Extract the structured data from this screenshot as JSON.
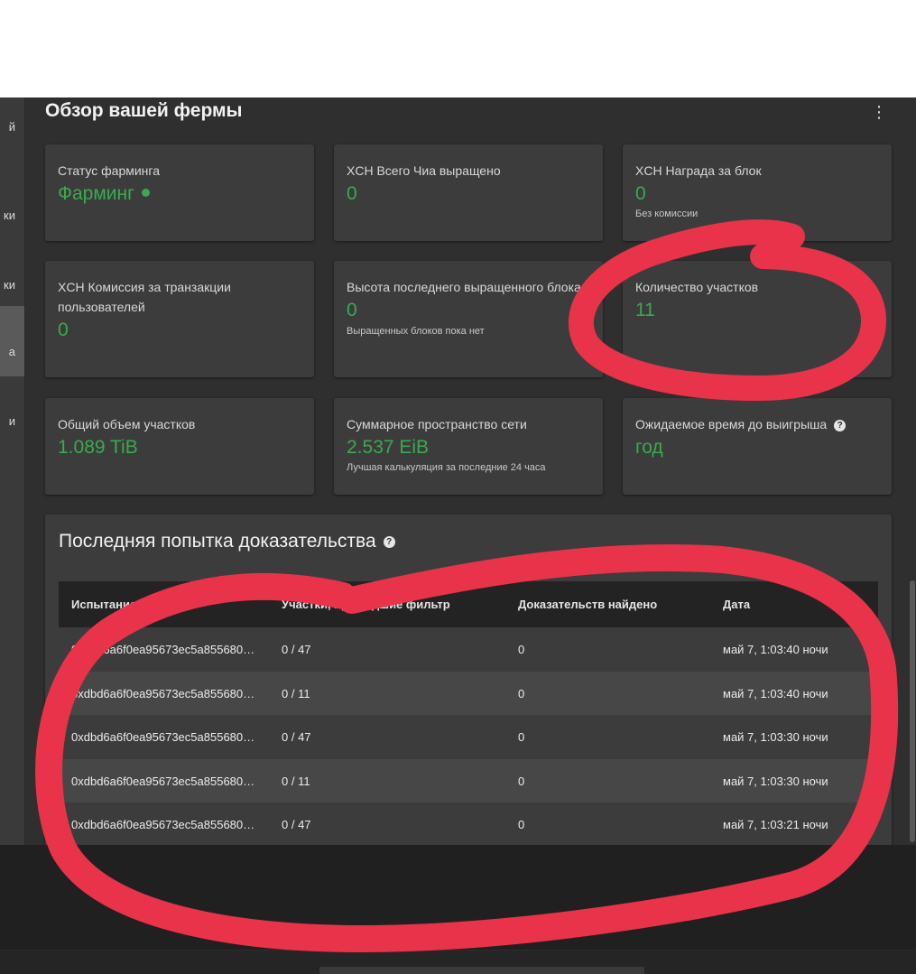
{
  "sidebar": {
    "items": [
      {
        "label": "й"
      },
      {
        "label": "ки"
      },
      {
        "label": "ки"
      },
      {
        "label": "а"
      },
      {
        "label": "и"
      }
    ]
  },
  "header": {
    "title": "Обзор вашей фермы",
    "more_icon": "more-vertical-icon"
  },
  "cards": {
    "farming_status": {
      "title": "Статус фарминга",
      "value": "Фарминг"
    },
    "total_farmed": {
      "title": "XCH Всего Чиа выращено",
      "value": "0"
    },
    "block_rewards": {
      "title": "XCH Награда за блок",
      "value": "0",
      "note": "Без комиссии"
    },
    "user_fees": {
      "title": "XCH Комиссия за транзакции пользователей",
      "value": "0"
    },
    "last_height": {
      "title": "Высота последнего выращенного блока",
      "value": "0",
      "note": "Выращенных блоков пока нет"
    },
    "plot_count": {
      "title": "Количество участков",
      "value": "11"
    },
    "total_size": {
      "title": "Общий объем участков",
      "value": "1.089 TiB"
    },
    "network_space": {
      "title": "Суммарное пространство сети",
      "value": "2.537 EiB",
      "note": "Лучшая калькуляция за последние 24 часа"
    },
    "time_to_win": {
      "title": "Ожидаемое время до выигрыша",
      "value": "год"
    }
  },
  "proofs": {
    "title": "Последняя попытка доказательства",
    "columns": [
      "Испытание",
      "Участки, прошедшие фильтр",
      "Доказательств найдено",
      "Дата"
    ],
    "rows": [
      {
        "challenge": "0xdbd6a6f0ea95673ec5a855680…",
        "plots": "0 / 47",
        "proofs": "0",
        "date": "май 7, 1:03:40 ночи"
      },
      {
        "challenge": "0xdbd6a6f0ea95673ec5a855680…",
        "plots": "0 / 11",
        "proofs": "0",
        "date": "май 7, 1:03:40 ночи"
      },
      {
        "challenge": "0xdbd6a6f0ea95673ec5a855680…",
        "plots": "0 / 47",
        "proofs": "0",
        "date": "май 7, 1:03:30 ночи"
      },
      {
        "challenge": "0xdbd6a6f0ea95673ec5a855680…",
        "plots": "0 / 11",
        "proofs": "0",
        "date": "май 7, 1:03:30 ночи"
      },
      {
        "challenge": "0xdbd6a6f0ea95673ec5a855680…",
        "plots": "0 / 47",
        "proofs": "0",
        "date": "май 7, 1:03:21 ночи"
      }
    ]
  },
  "colors": {
    "accent_green": "#3aaa4f",
    "annotation_red": "#e8334a",
    "background": "#2f2f2f",
    "card": "#3c3c3c"
  }
}
